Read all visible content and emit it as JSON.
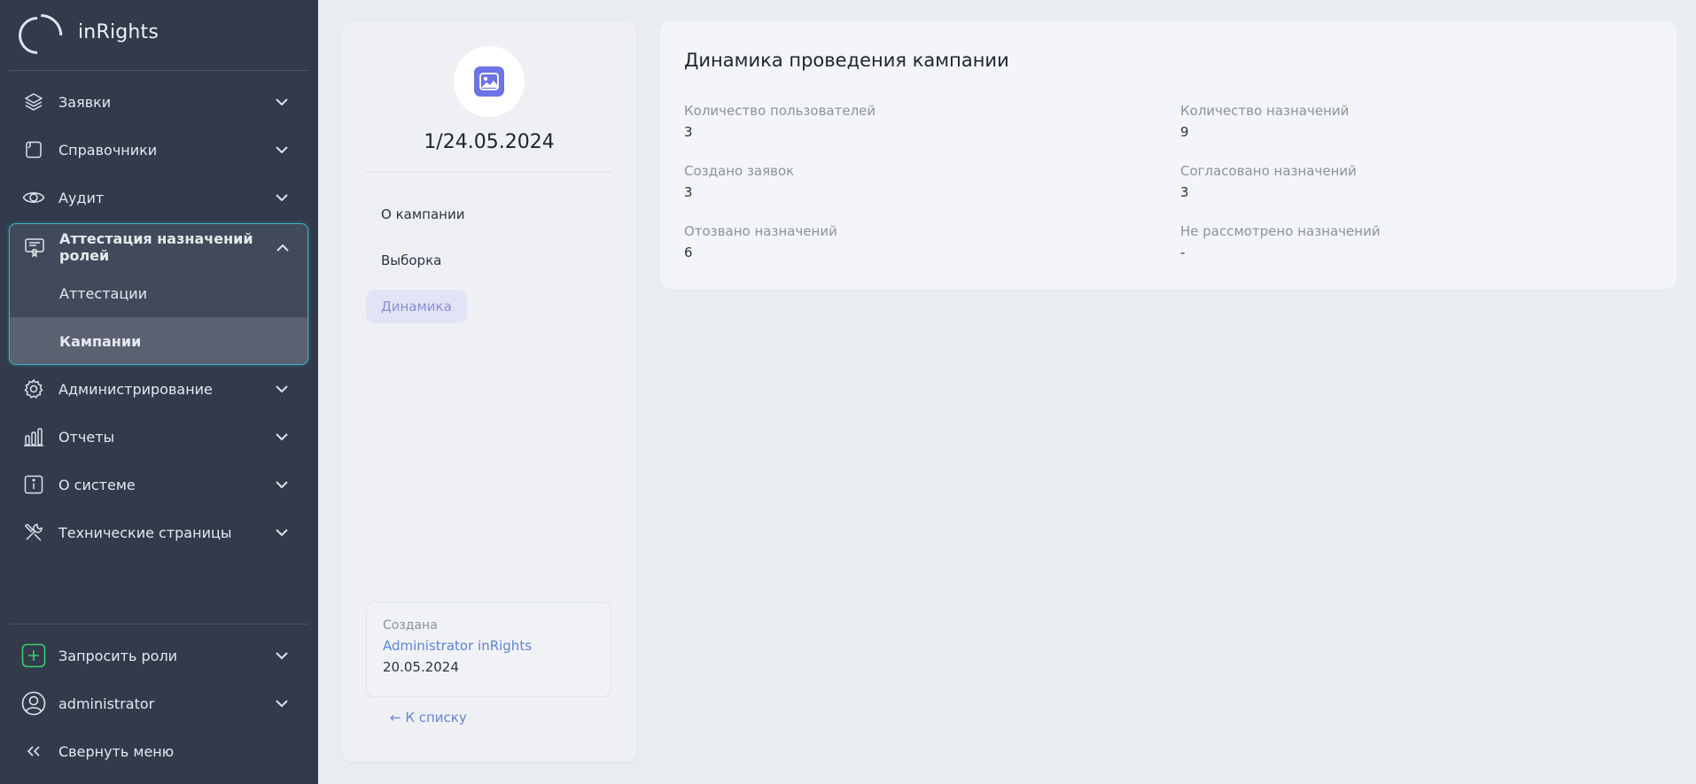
{
  "app": {
    "name": "inRights"
  },
  "sidebar": {
    "items": [
      {
        "label": "Заявки",
        "icon": "layers-icon"
      },
      {
        "label": "Справочники",
        "icon": "book-icon"
      },
      {
        "label": "Аудит",
        "icon": "eye-icon"
      },
      {
        "label": "Аттестация назначений ролей",
        "icon": "certificate-icon",
        "expanded": true,
        "children": [
          {
            "label": "Аттестации"
          },
          {
            "label": "Кампании",
            "active": true
          }
        ]
      },
      {
        "label": "Администрирование",
        "icon": "gear-icon"
      },
      {
        "label": "Отчеты",
        "icon": "bar-chart-icon"
      },
      {
        "label": "О системе",
        "icon": "info-icon"
      },
      {
        "label": "Технические страницы",
        "icon": "tools-icon"
      }
    ],
    "bottom": {
      "request_roles": "Запросить роли",
      "user": "administrator",
      "collapse": "Свернуть меню"
    }
  },
  "campaign": {
    "title": "1/24.05.2024",
    "tabs": [
      "О кампании",
      "Выборка",
      "Динамика"
    ],
    "active_tab": "Динамика",
    "created": {
      "caption": "Создана",
      "author": "Administrator inRights",
      "date": "20.05.2024"
    },
    "back_label": "← К списку"
  },
  "dynamics": {
    "title": "Динамика проведения кампании",
    "stats": [
      {
        "label": "Количество пользователей",
        "value": "3"
      },
      {
        "label": "Количество назначений",
        "value": "9"
      },
      {
        "label": "Создано заявок",
        "value": "3"
      },
      {
        "label": "Согласовано назначений",
        "value": "3"
      },
      {
        "label": "Отозвано назначений",
        "value": "6"
      },
      {
        "label": "Не рассмотрено назначений",
        "value": "-"
      }
    ]
  },
  "colors": {
    "sidebar_bg": "#323a4b",
    "accent": "#6e73e8",
    "active_outline": "#3fb2c4",
    "request_green": "#3ecf6a",
    "link_blue": "#5d85d6"
  }
}
